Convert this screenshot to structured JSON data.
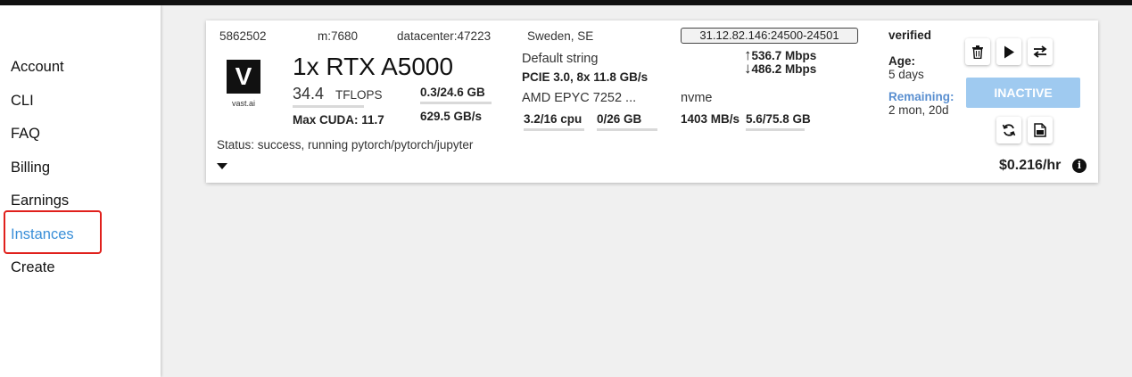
{
  "sidebar": {
    "items": [
      {
        "label": "Account"
      },
      {
        "label": "CLI"
      },
      {
        "label": "FAQ"
      },
      {
        "label": "Billing"
      },
      {
        "label": "Earnings"
      },
      {
        "label": "Instances"
      },
      {
        "label": "Create"
      }
    ],
    "active": "Instances"
  },
  "instance": {
    "id": "5862502",
    "machine": "m:7680",
    "datacenter": "datacenter:47223",
    "location": "Sweden, SE",
    "ip_ports": "31.12.82.146:24500-24501",
    "status_verified": "verified",
    "logo_letter": "V",
    "logo_text": "vast.ai",
    "gpu_name": "1x RTX A5000",
    "tflops_value": "34.4",
    "tflops_unit": "TFLOPS",
    "max_cuda": "Max CUDA: 11.7",
    "vram": "0.3/24.6 GB",
    "bandwidth": "629.5 GB/s",
    "motherboard": "Default string",
    "pcie": "PCIE 3.0, 8x  11.8 GB/s",
    "cpu_name": "AMD EPYC 7252 ...",
    "cpu_usage": "3.2/16 cpu",
    "ram_usage": "0/26 GB",
    "upload": "536.7 Mbps",
    "download": "486.2 Mbps",
    "disk_type": "nvme",
    "disk_speed": "1403 MB/s",
    "disk_usage": "5.6/75.8 GB",
    "age_label": "Age:",
    "age_value": "5 days",
    "remaining_label": "Remaining:",
    "remaining_value": "2 mon, 20d",
    "status_text": "Status: success, running pytorch/pytorch/jupyter",
    "inactive_label": "INACTIVE",
    "price": "$0.216/hr",
    "info_glyph": "i"
  },
  "icons": [
    "trash-icon",
    "play-icon",
    "transfer-icon",
    "refresh-icon",
    "log-icon",
    "info-icon",
    "chevron-down-icon"
  ],
  "colors": {
    "accent": "#3a8fd8",
    "inactive_button": "#9fcaf0",
    "highlight_border": "#e0201c",
    "remaining_label": "#5a8fd0"
  },
  "usage": {
    "tflops_fraction": 0.0,
    "vram_fraction": 0.012,
    "cpu_fraction": 0.2,
    "ram_fraction": 0.0,
    "disk_fraction": 0.074
  }
}
